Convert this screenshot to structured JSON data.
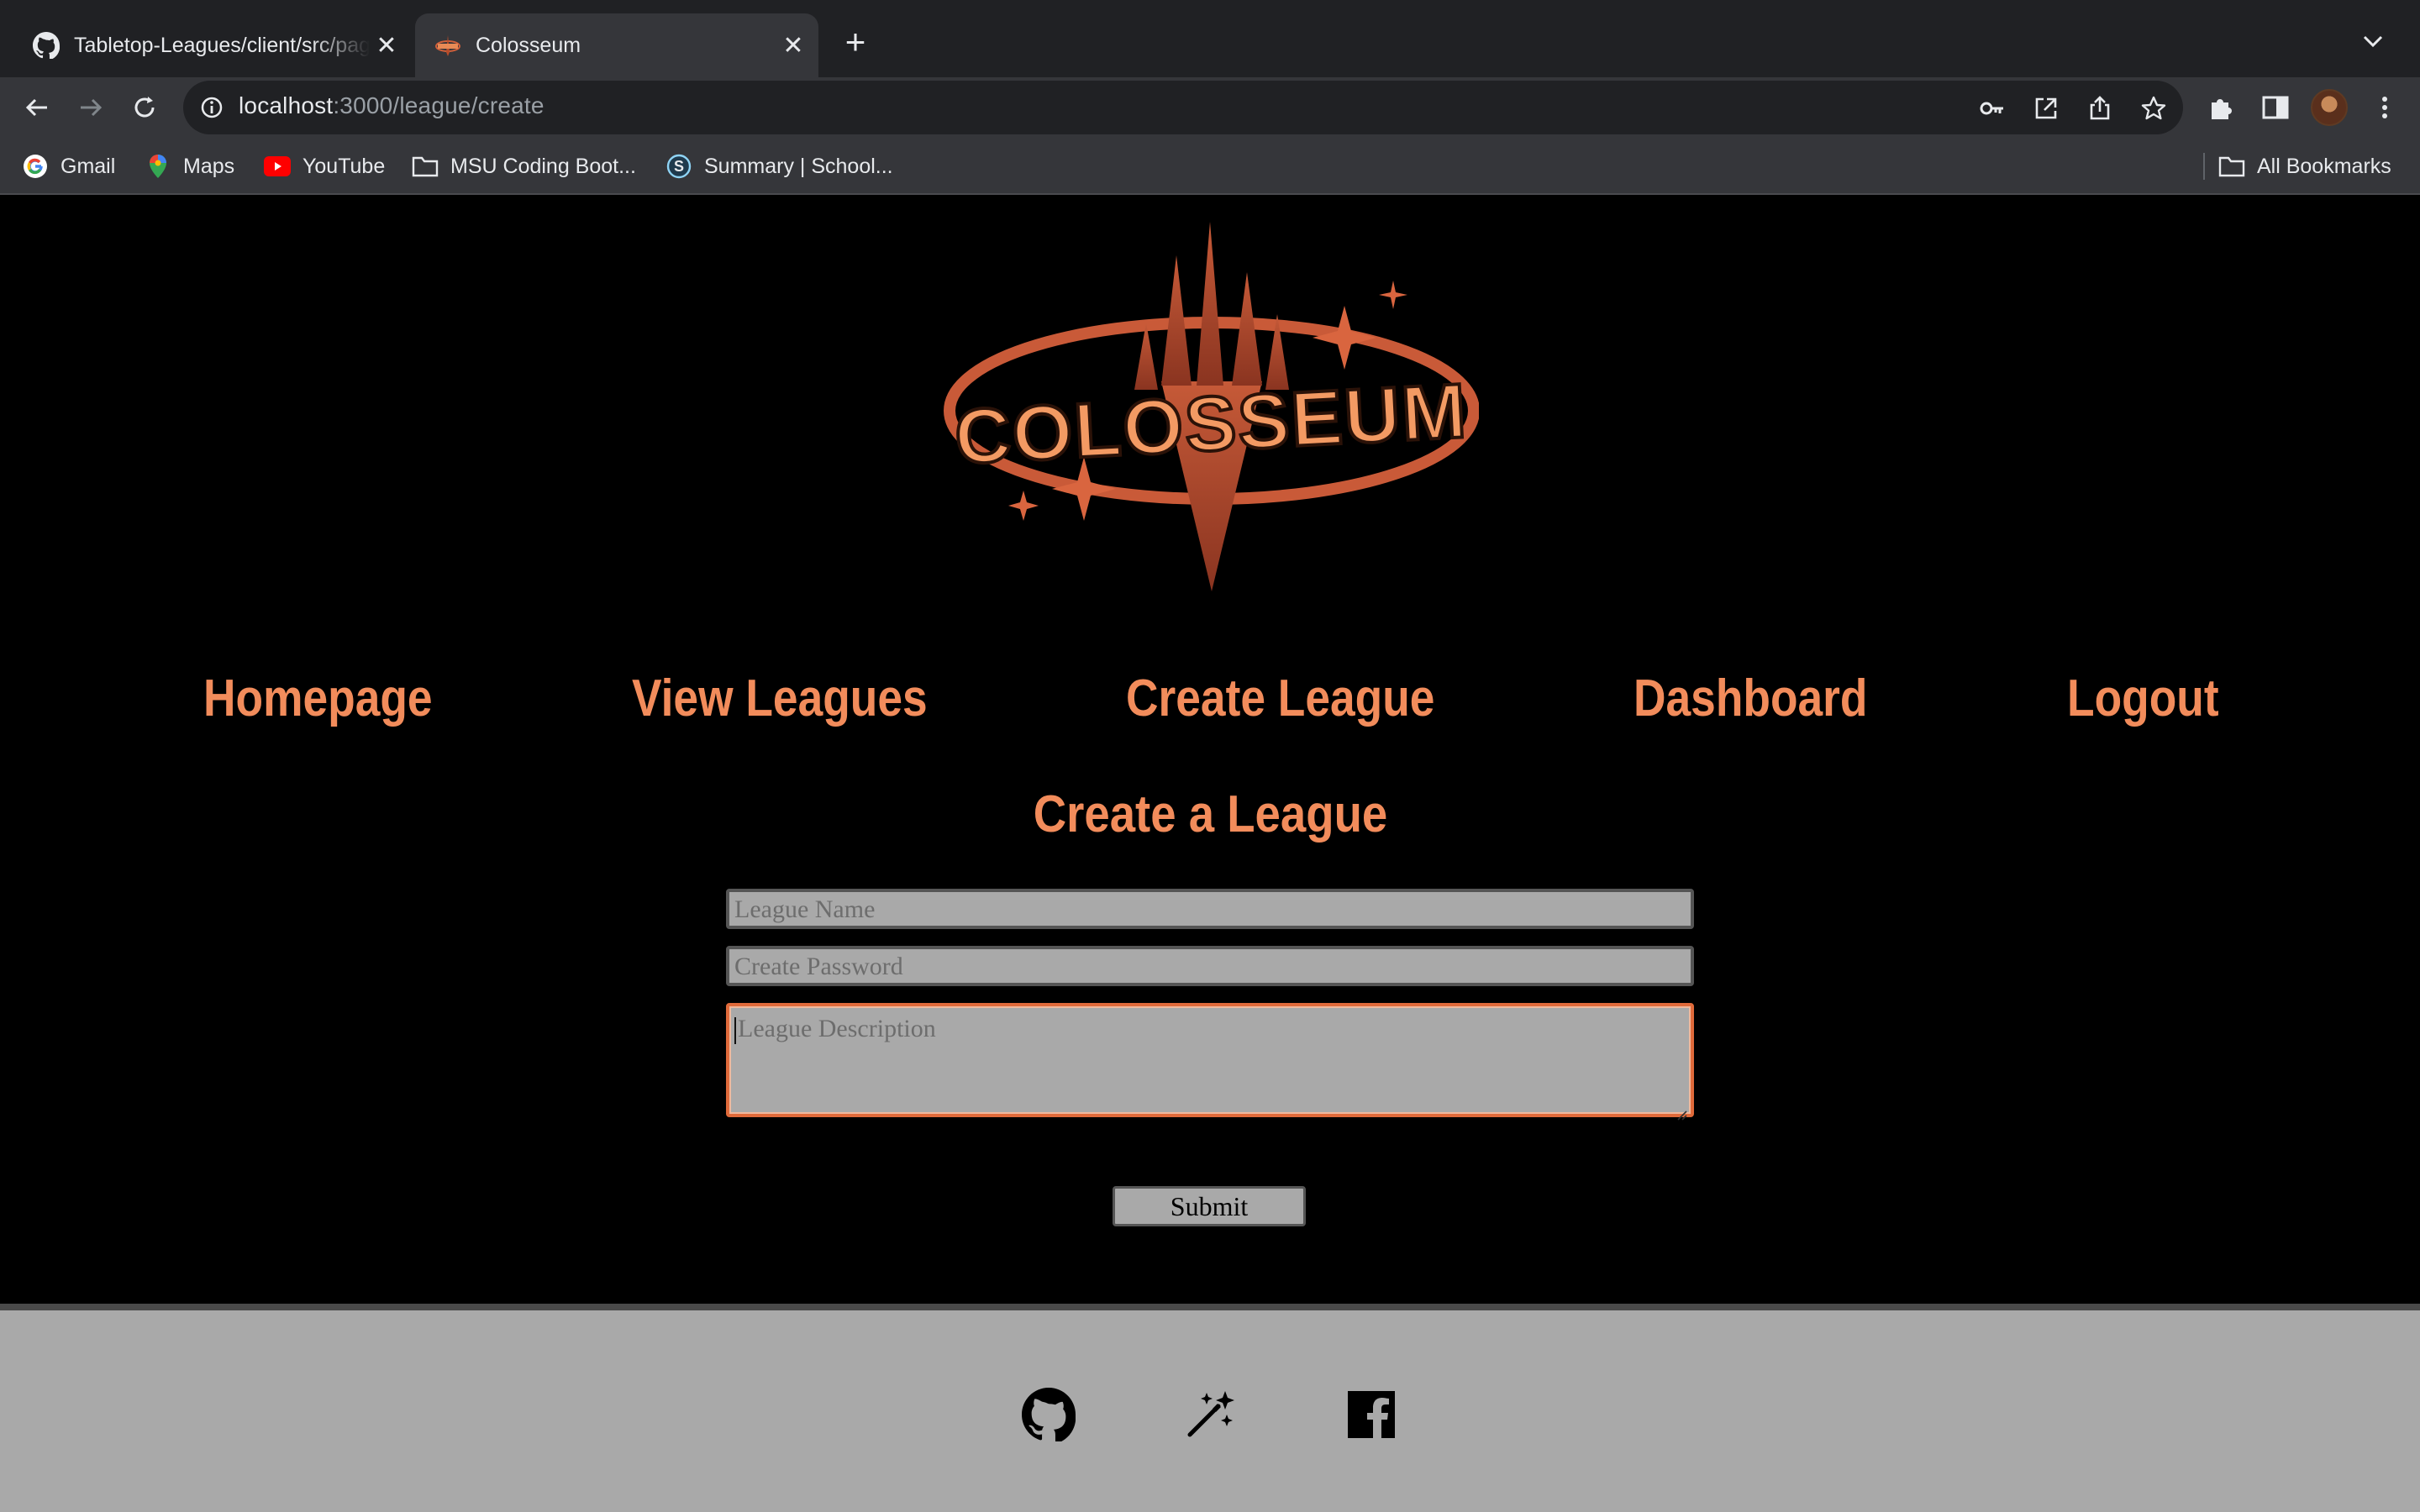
{
  "browser": {
    "tabs": [
      {
        "title": "Tabletop-Leagues/client/src/pages",
        "favicon": "github-icon",
        "active": false
      },
      {
        "title": "Colosseum",
        "favicon": "colosseum-icon",
        "active": true
      }
    ],
    "url": {
      "host": "localhost",
      "path": ":3000/league/create"
    },
    "bookmarks": [
      {
        "label": "Gmail",
        "icon": "google-icon"
      },
      {
        "label": "Maps",
        "icon": "maps-icon"
      },
      {
        "label": "YouTube",
        "icon": "youtube-icon"
      },
      {
        "label": "MSU Coding Boot...",
        "icon": "folder-icon"
      },
      {
        "label": "Summary | School...",
        "icon": "s-icon"
      }
    ],
    "all_bookmarks": "All Bookmarks"
  },
  "site": {
    "logo_text": "COLOSSEUM",
    "nav": [
      "Homepage",
      "View Leagues",
      "Create League",
      "Dashboard",
      "Logout"
    ],
    "heading": "Create a League"
  },
  "form": {
    "league_name_placeholder": "League Name",
    "password_placeholder": "Create Password",
    "description_placeholder": "League Description",
    "submit_label": "Submit"
  },
  "footer": {
    "icons": [
      "github-icon",
      "magic-wand-icon",
      "facebook-icon"
    ]
  },
  "colors": {
    "accent": "#f28c5b",
    "page_bg": "#000000",
    "footer_bg": "#a9a9a9",
    "input_bg": "#a9a9a9"
  }
}
